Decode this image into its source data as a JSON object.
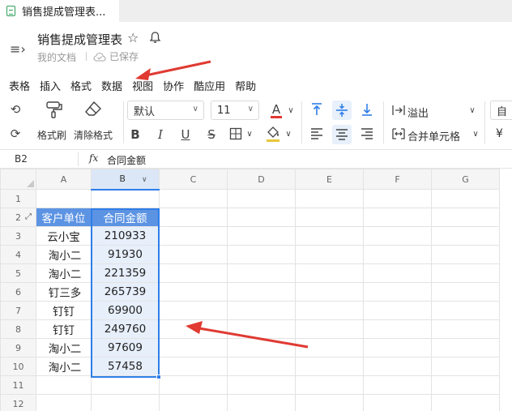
{
  "tab": {
    "title": "销售提成管理表..."
  },
  "header": {
    "doc_title": "销售提成管理表",
    "breadcrumb": "我的文档",
    "save_status": "已保存"
  },
  "menubar": [
    "表格",
    "插入",
    "格式",
    "数据",
    "视图",
    "协作",
    "酷应用",
    "帮助"
  ],
  "toolbar": {
    "format_painter": "格式刷",
    "clear_format": "清除格式",
    "font_family": "默认",
    "font_size": "11",
    "font_color_glyph": "A",
    "overflow": "溢出",
    "merge_cells": "合并单元格",
    "auto_partial": "自",
    "currency_partial": "¥",
    "bold": "B",
    "italic": "I",
    "underline": "U",
    "strike": "S"
  },
  "formula_bar": {
    "cell_ref": "B2",
    "fx": "fx",
    "value": "合同金额"
  },
  "grid": {
    "columns": [
      "A",
      "B",
      "C",
      "D",
      "E",
      "F",
      "G"
    ],
    "row_numbers": [
      "1",
      "2",
      "3",
      "4",
      "5",
      "6",
      "7",
      "8",
      "9",
      "10",
      "11",
      "12"
    ],
    "header_row": {
      "a": "客户单位",
      "b": "合同金额"
    },
    "rows": [
      {
        "a": "云小宝",
        "b": "210933"
      },
      {
        "a": "淘小二",
        "b": "91930"
      },
      {
        "a": "淘小二",
        "b": "221359"
      },
      {
        "a": "钉三多",
        "b": "265739"
      },
      {
        "a": "钉钉",
        "b": "69900"
      },
      {
        "a": "钉钉",
        "b": "249760"
      },
      {
        "a": "淘小二",
        "b": "97609"
      },
      {
        "a": "淘小二",
        "b": "57458"
      }
    ]
  },
  "colors": {
    "accent": "#2f7ee8",
    "header_fill": "#5c93e3",
    "arrow": "#e03a32"
  }
}
